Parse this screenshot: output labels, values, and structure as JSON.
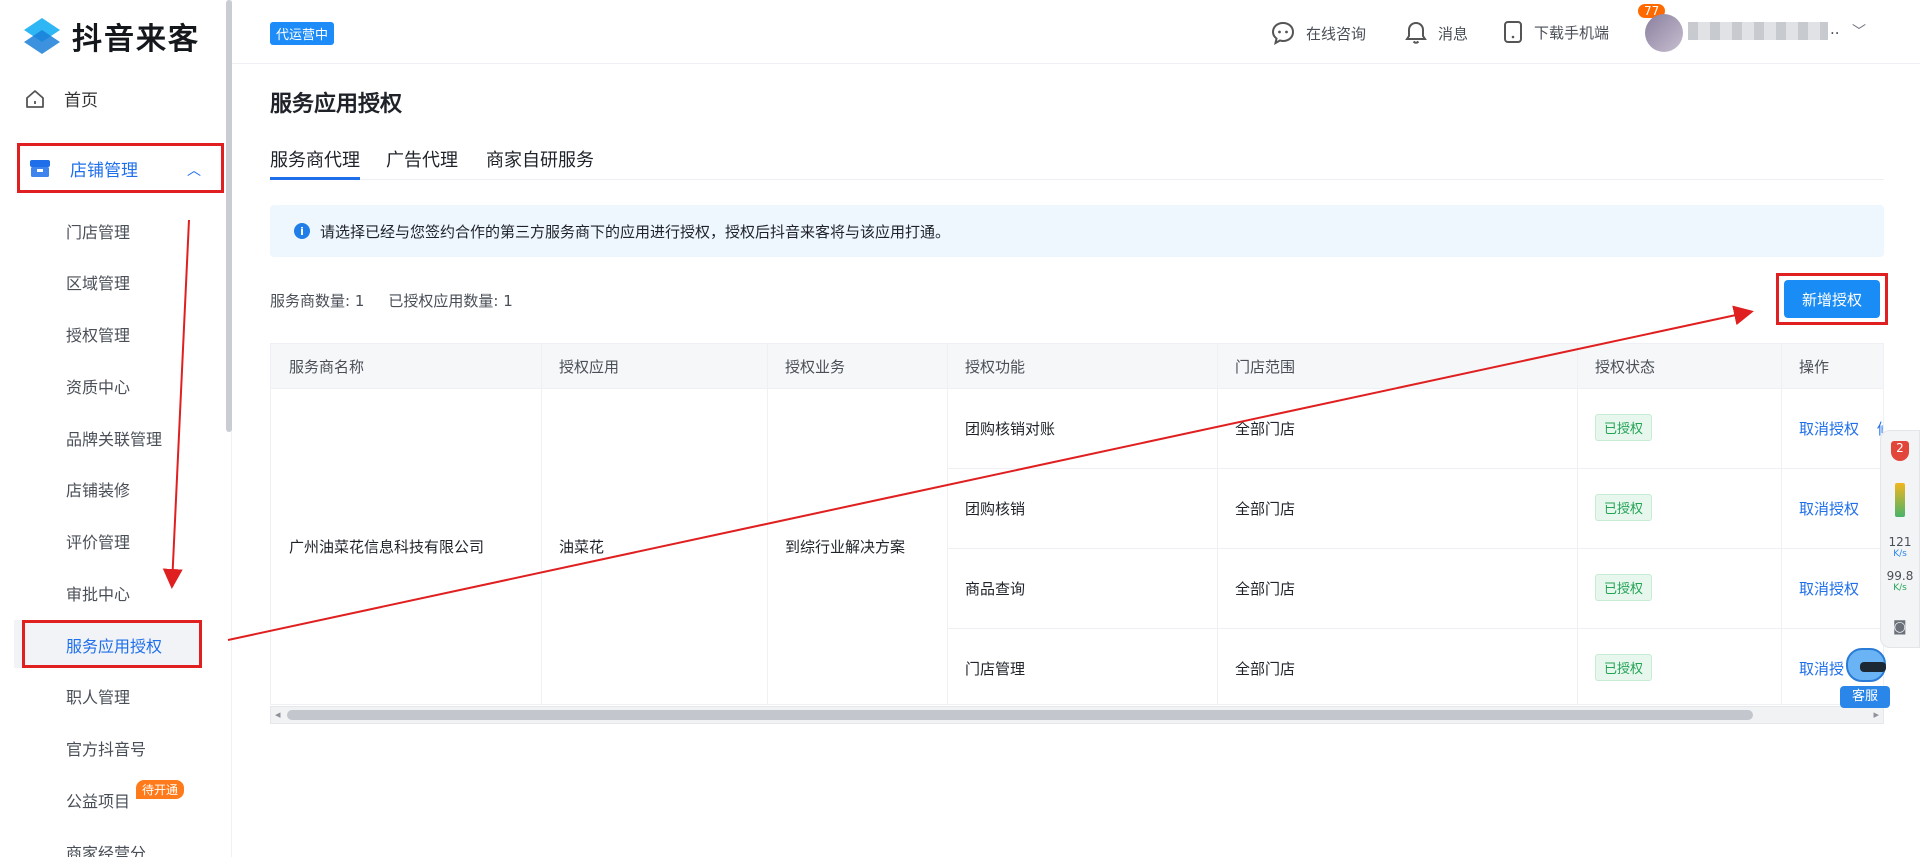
{
  "sidebar": {
    "brand": "抖音来客",
    "home": "首页",
    "store_management": "店铺管理",
    "items": [
      "门店管理",
      "区域管理",
      "授权管理",
      "资质中心",
      "品牌关联管理",
      "店铺装修",
      "评价管理",
      "审批中心",
      "服务应用授权",
      "职人管理",
      "官方抖音号",
      "公益项目",
      "商家经营分"
    ],
    "pending_badge": "待开通"
  },
  "header": {
    "operating_tag": "代运营中",
    "online_consult": "在线咨询",
    "messages": "消息",
    "message_count": "77",
    "download_app": "下载手机端",
    "user_suffix": ".."
  },
  "page": {
    "title": "服务应用授权",
    "tabs": [
      "服务商代理",
      "广告代理",
      "商家自研服务"
    ],
    "notice": "请选择已经与您签约合作的第三方服务商下的应用进行授权，授权后抖音来客将与该应用打通。",
    "stats": {
      "provider_count": "服务商数量: 1",
      "authorized_app_count": "已授权应用数量: 1"
    },
    "new_auth_button": "新增授权"
  },
  "table": {
    "columns": [
      "服务商名称",
      "授权应用",
      "授权业务",
      "授权功能",
      "门店范围",
      "授权状态",
      "操作"
    ],
    "group": {
      "provider": "广州油菜花信息科技有限公司",
      "app": "油菜花",
      "business": "到综行业解决方案"
    },
    "rows": [
      {
        "function": "团购核销对账",
        "scope": "全部门店",
        "status": "已授权",
        "action": "取消授权",
        "extra": "修"
      },
      {
        "function": "团购核销",
        "scope": "全部门店",
        "status": "已授权",
        "action": "取消授权",
        "extra": ""
      },
      {
        "function": "商品查询",
        "scope": "全部门店",
        "status": "已授权",
        "action": "取消授权",
        "extra": ""
      },
      {
        "function": "门店管理",
        "scope": "全部门店",
        "status": "已授权",
        "action": "取消授",
        "extra": ""
      }
    ]
  },
  "float_panel": {
    "shield_count": "2",
    "upload_speed": "121",
    "download_speed": "99.8",
    "speed_unit": "K/s"
  },
  "customer_service": "客服",
  "colors": {
    "accent": "#1f6feb",
    "primary_button": "#1a8cf5",
    "annotation_red": "#e02020",
    "status_green": "#23a455"
  }
}
